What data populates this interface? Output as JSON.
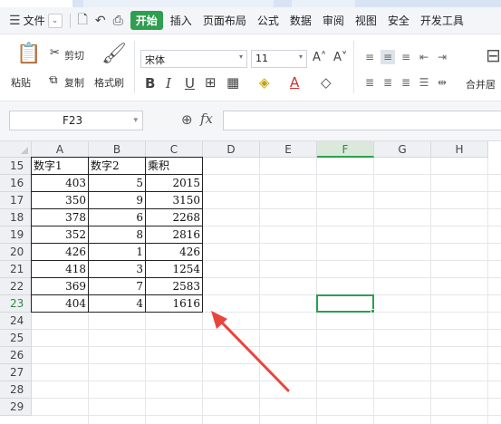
{
  "menubar": {
    "file_label": "文件",
    "tabs": [
      "开始",
      "插入",
      "页面布局",
      "公式",
      "数据",
      "审阅",
      "视图",
      "安全",
      "开发工具"
    ],
    "active_tab": "开始"
  },
  "ribbon": {
    "paste_label": "粘贴",
    "cut_label": "剪切",
    "copy_label": "复制",
    "format_painter_label": "格式刷",
    "font_name": "宋体",
    "font_size": "11",
    "merge_label": "合并居"
  },
  "formula_bar": {
    "name_box": "F23",
    "fx_label": "fx",
    "formula": ""
  },
  "grid": {
    "columns": [
      "A",
      "B",
      "C",
      "D",
      "E",
      "F",
      "G",
      "H"
    ],
    "active_column": "F",
    "rows": [
      "15",
      "16",
      "17",
      "18",
      "19",
      "20",
      "21",
      "22",
      "23",
      "24",
      "25",
      "26",
      "27",
      "28",
      "29"
    ],
    "active_row": "23",
    "headers": [
      "数字1",
      "数字2",
      "乘积"
    ],
    "data": [
      [
        "403",
        "5",
        "2015"
      ],
      [
        "350",
        "9",
        "3150"
      ],
      [
        "378",
        "6",
        "2268"
      ],
      [
        "352",
        "8",
        "2816"
      ],
      [
        "426",
        "1",
        "426"
      ],
      [
        "418",
        "3",
        "1254"
      ],
      [
        "369",
        "7",
        "2583"
      ],
      [
        "404",
        "4",
        "1616"
      ]
    ],
    "selected_cell": "F23"
  },
  "colors": {
    "accent_green": "#2d9f4f",
    "annotation_arrow": "#e8463c"
  },
  "icons": [
    "hamburger-menu-icon",
    "save-icon",
    "undo-icon",
    "print-icon",
    "paste-icon",
    "cut-icon",
    "copy-icon",
    "format-painter-icon",
    "zoom-icon",
    "arrow-annotation"
  ]
}
